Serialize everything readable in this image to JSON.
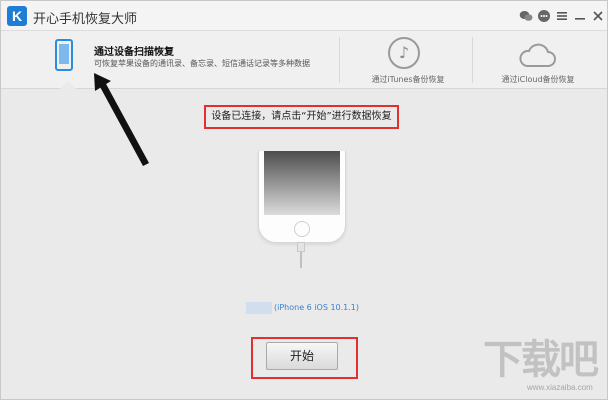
{
  "window": {
    "title": "开心手机恢复大师",
    "logo_letter": "K"
  },
  "titlebar_icons": [
    "wechat-icon",
    "chat-icon",
    "menu-icon",
    "minimize-icon",
    "close-icon"
  ],
  "nav": {
    "scan": {
      "title": "通过设备扫描恢复",
      "desc": "可恢复苹果设备的通讯录、备忘录、短信通话记录等多种数据"
    },
    "itunes": {
      "label": "通过iTunes备份恢复"
    },
    "icloud": {
      "label": "通过iCloud备份恢复"
    }
  },
  "main": {
    "status_text": "设备已连接，请点击“开始”进行数据恢复",
    "device_model": "(iPhone 6 iOS 10.1.1)",
    "start_label": "开始"
  },
  "colors": {
    "accent": "#2b8de0",
    "annotation": "#e03030"
  },
  "watermark": {
    "text": "下载吧",
    "url": "www.xiazaiba.com"
  }
}
